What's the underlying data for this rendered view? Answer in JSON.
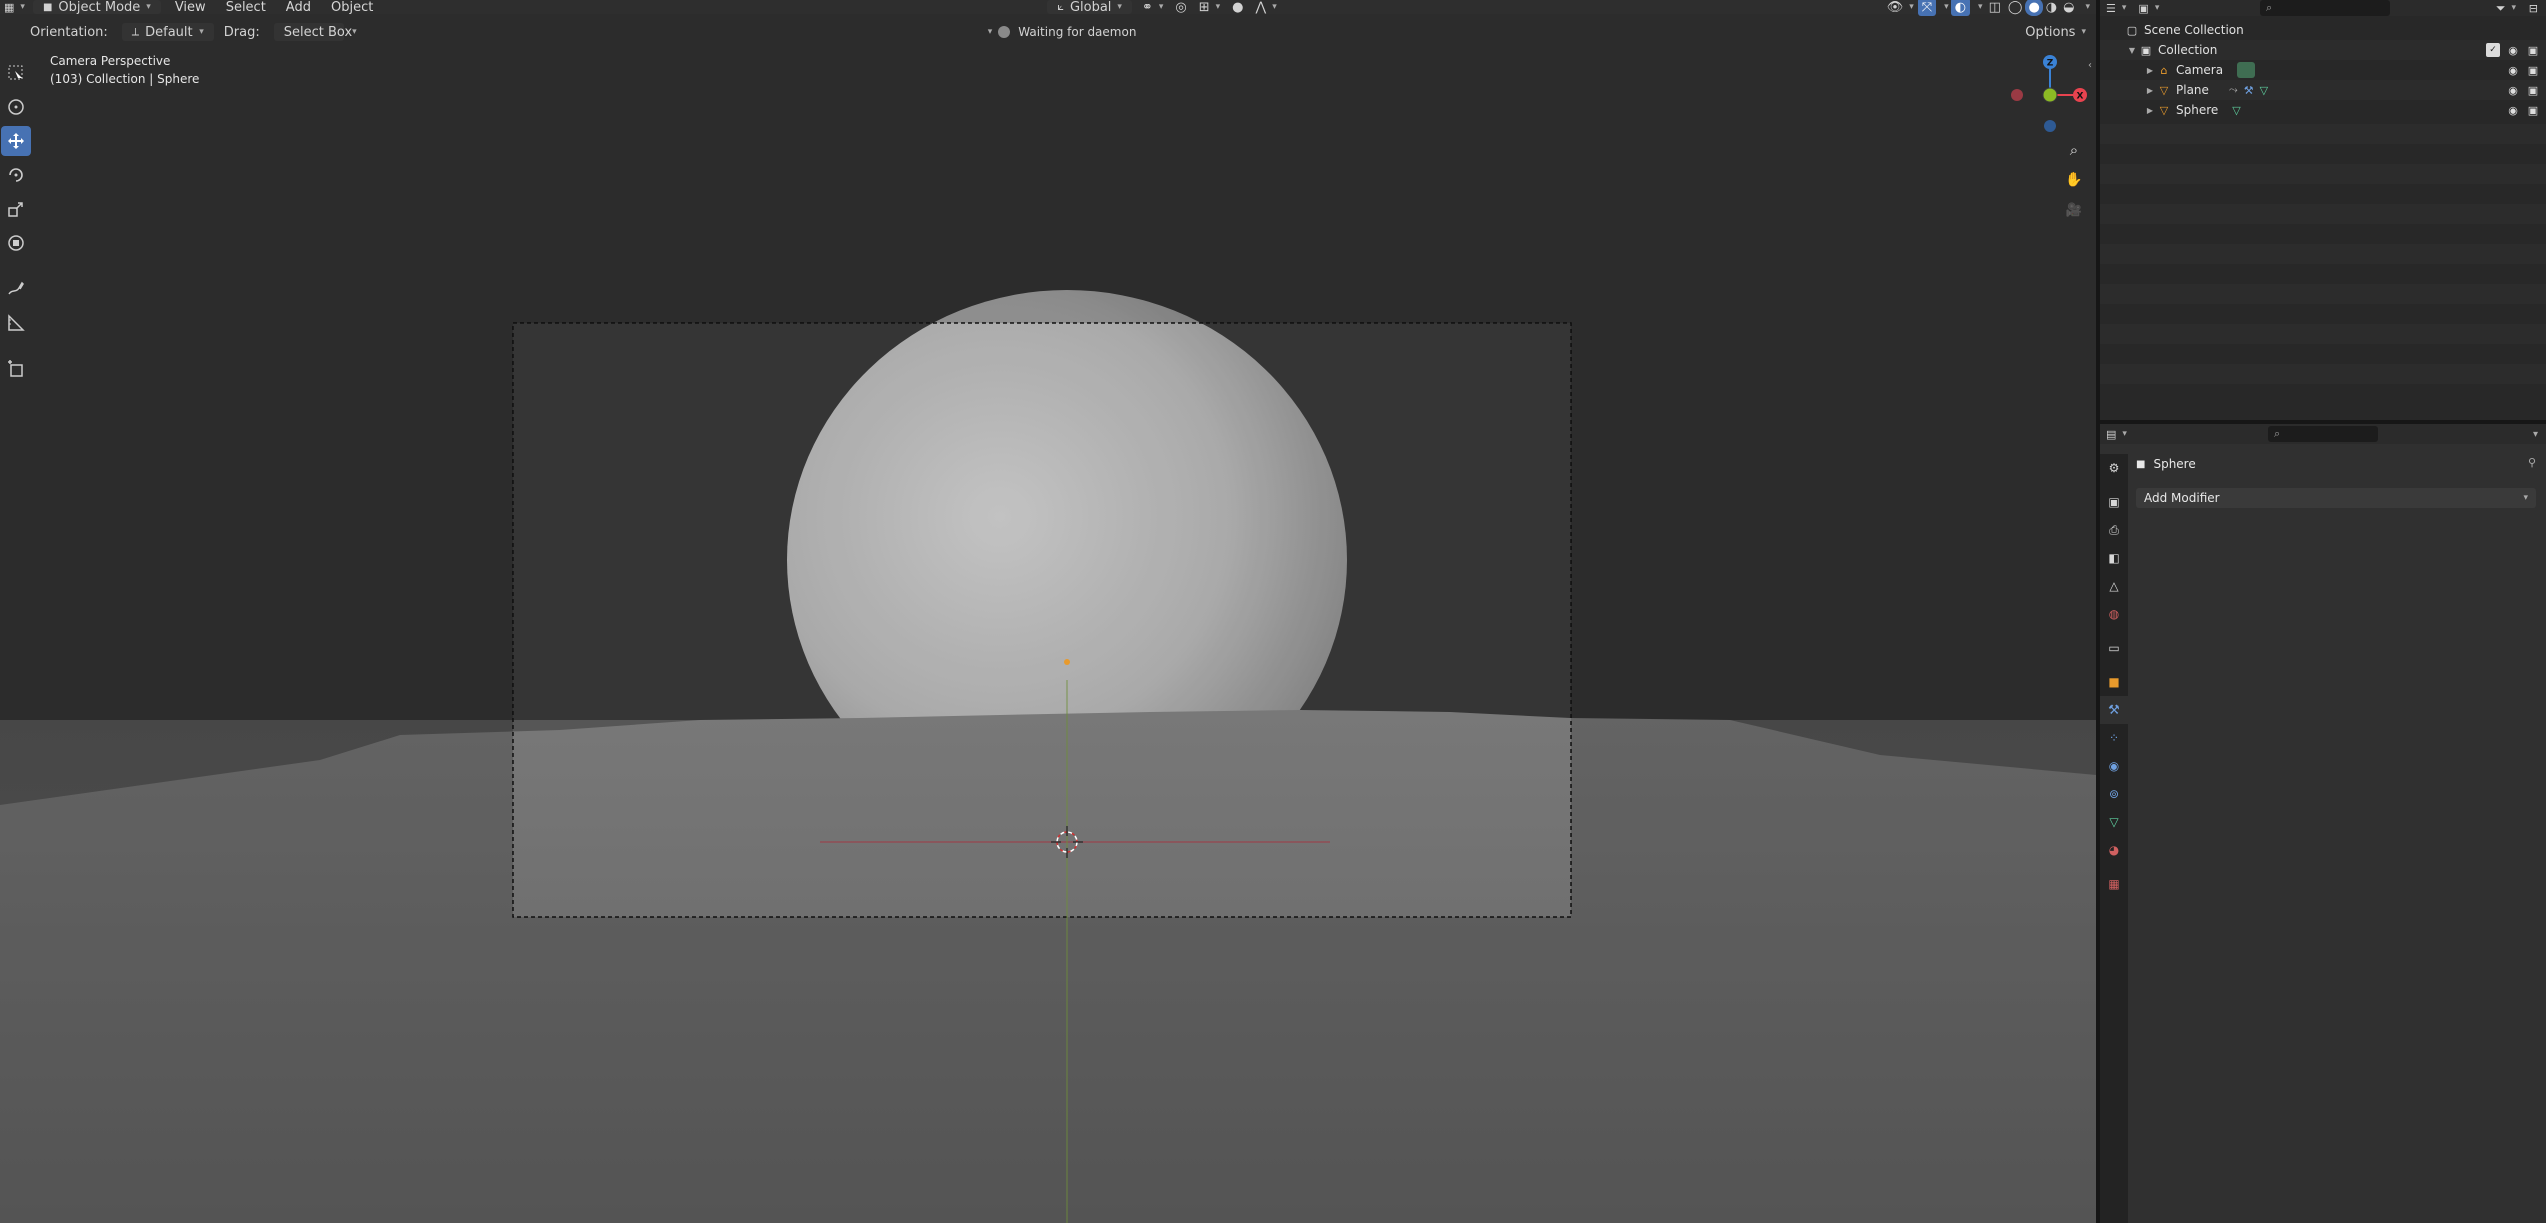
{
  "header": {
    "mode": "Object Mode",
    "menus": [
      "View",
      "Select",
      "Add",
      "Object"
    ],
    "transform_orientation": "Global"
  },
  "tool_settings": {
    "orientation_label": "Orientation:",
    "orientation_value": "Default",
    "drag_label": "Drag:",
    "drag_value": "Select Box",
    "status": "Waiting for daemon",
    "options": "Options"
  },
  "viewport": {
    "view_name": "Camera Perspective",
    "context": "(103) Collection | Sphere"
  },
  "gizmo": {
    "axes": [
      "Z",
      "X"
    ],
    "colors": {
      "x": "#e8434f",
      "y": "#8cba24",
      "z": "#3a82d6"
    }
  },
  "outliner": {
    "root": "Scene Collection",
    "collection": "Collection",
    "objects": [
      {
        "name": "Camera",
        "icon": "camera-icon"
      },
      {
        "name": "Plane",
        "icon": "mesh-icon"
      },
      {
        "name": "Sphere",
        "icon": "mesh-icon"
      }
    ]
  },
  "properties": {
    "object_name": "Sphere",
    "add_modifier": "Add Modifier",
    "active_tab": "modifier-tab"
  },
  "colors": {
    "accent": "#4772b3",
    "viewport_bg": "#393939",
    "panel_bg": "#303030"
  }
}
